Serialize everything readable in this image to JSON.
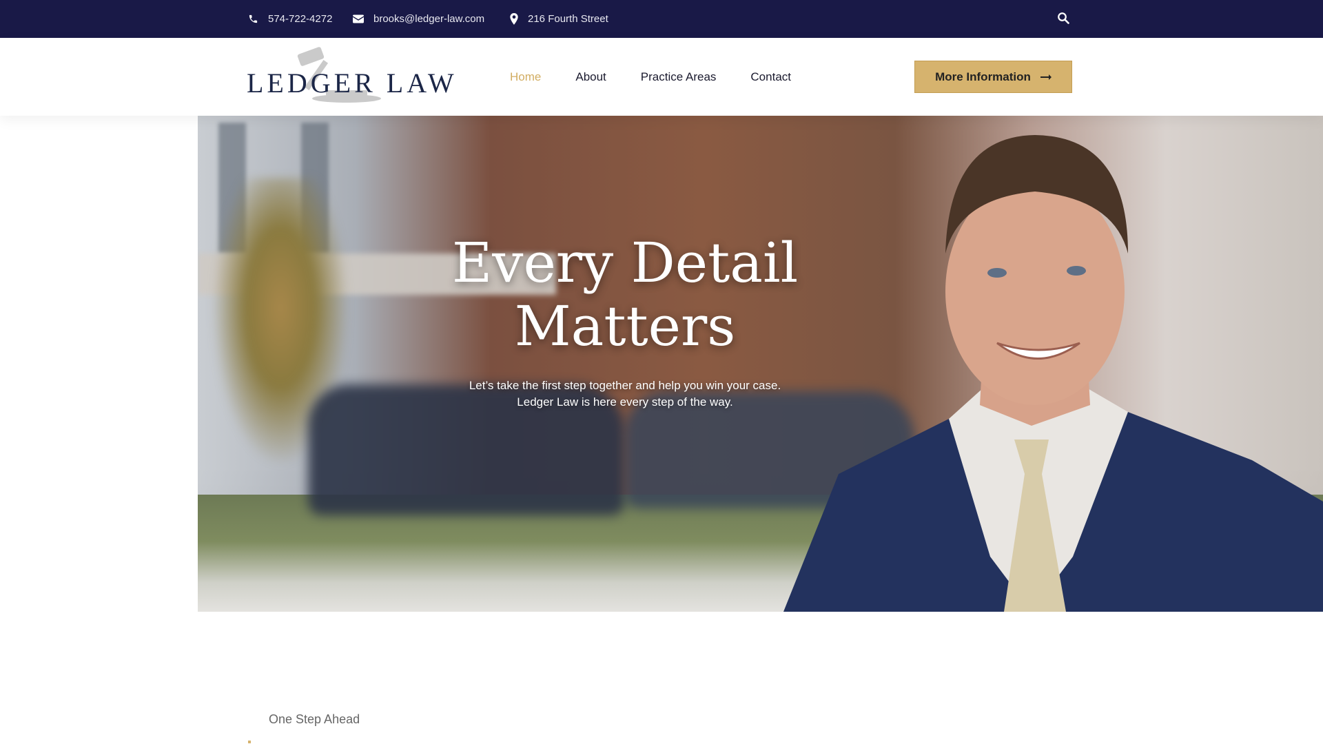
{
  "topbar": {
    "phone": "574-722-4272",
    "email": "brooks@ledger-law.com",
    "address": "216 Fourth Street",
    "icons": [
      "phone-icon",
      "envelope-icon",
      "map-pin-icon",
      "search-icon"
    ]
  },
  "header": {
    "logo_text": "LEDGER LAW",
    "nav": [
      "Home",
      "About",
      "Practice Areas",
      "Contact"
    ],
    "active_nav": "Home",
    "cta_label": "More Information"
  },
  "hero": {
    "title_line1": "Every Detail",
    "title_line2": "Matters",
    "subtitle_line1": "Let’s take the first step together and help you win your case.",
    "subtitle_line2": "Ledger Law is here every step of the way."
  },
  "section": {
    "eyebrow": "One Step Ahead"
  },
  "colors": {
    "topbar_bg": "#191947",
    "accent": "#d6b36e",
    "nav_active": "#d2ad62",
    "logo": "#1b2647"
  }
}
